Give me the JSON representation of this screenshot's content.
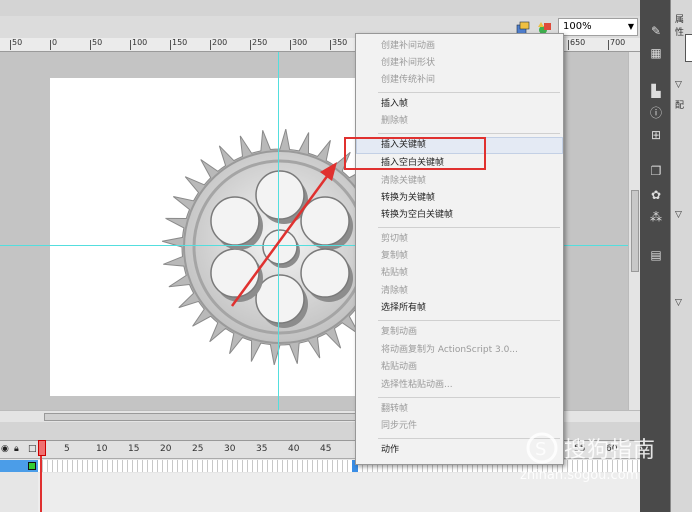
{
  "toolbar": {
    "zoom": "100%",
    "icons": [
      "edit-scene-icon",
      "edit-symbol-icon"
    ]
  },
  "ruler": {
    "ticks": [
      "50",
      "0",
      "50",
      "100",
      "150",
      "200",
      "250",
      "300",
      "350",
      "650",
      "700"
    ]
  },
  "timeline": {
    "frame_numbers": [
      "1",
      "5",
      "10",
      "15",
      "20",
      "25",
      "30",
      "35",
      "40",
      "45",
      "55",
      "60"
    ],
    "controls": [
      "eye-icon",
      "lock-icon",
      "outline-icon"
    ]
  },
  "properties_panel": {
    "title": "属性",
    "label": "配"
  },
  "context_menu": {
    "items": [
      {
        "label": "创建补间动画",
        "enabled": false
      },
      {
        "label": "创建补间形状",
        "enabled": false
      },
      {
        "label": "创建传统补间",
        "enabled": false
      },
      {
        "label": "插入帧",
        "enabled": true
      },
      {
        "label": "删除帧",
        "enabled": false
      },
      {
        "label": "插入关键帧",
        "enabled": true
      },
      {
        "label": "插入空白关键帧",
        "enabled": true
      },
      {
        "label": "清除关键帧",
        "enabled": false
      },
      {
        "label": "转换为关键帧",
        "enabled": true
      },
      {
        "label": "转换为空白关键帧",
        "enabled": true
      },
      {
        "label": "剪切帧",
        "enabled": false
      },
      {
        "label": "复制帧",
        "enabled": false
      },
      {
        "label": "粘贴帧",
        "enabled": false
      },
      {
        "label": "清除帧",
        "enabled": false
      },
      {
        "label": "选择所有帧",
        "enabled": true
      },
      {
        "label": "复制动画",
        "enabled": false
      },
      {
        "label": "将动画复制为 ActionScript 3.0...",
        "enabled": false
      },
      {
        "label": "粘贴动画",
        "enabled": false
      },
      {
        "label": "选择性粘贴动画...",
        "enabled": false
      },
      {
        "label": "翻转帧",
        "enabled": false
      },
      {
        "label": "同步元件",
        "enabled": false
      },
      {
        "label": "动作",
        "enabled": true
      }
    ]
  },
  "annotation": {
    "highlight_color": "#e0312f",
    "arrow_color": "#e0312f"
  },
  "watermark": {
    "title": "搜狗指南",
    "url": "zhinan.sogou.com"
  },
  "colors": {
    "guide": "#53dede",
    "playhead": "#e03030",
    "selected_frame": "#3a8ee6"
  }
}
